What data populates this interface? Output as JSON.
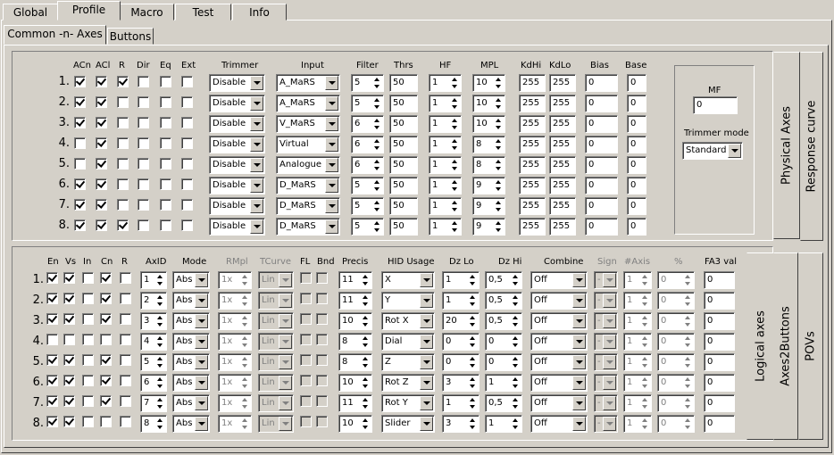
{
  "tabs": {
    "main": [
      "Global",
      "Profile",
      "Macro",
      "Test",
      "Info"
    ],
    "sub": [
      "Common -n- Axes",
      "Buttons"
    ]
  },
  "side_tabs": {
    "top": [
      "Physical Axes",
      "Response curve"
    ],
    "bottom": [
      "Logical axes",
      "Axes2Buttons",
      "POVs"
    ]
  },
  "physical": {
    "headers": [
      "ACn",
      "ACl",
      "R",
      "Dir",
      "Eq",
      "Ext",
      "Trimmer",
      "Input",
      "Filter",
      "Thrs",
      "HF",
      "MPL",
      "KdHi",
      "KdLo",
      "Bias",
      "Base"
    ],
    "rows": [
      {
        "num": "1.",
        "checks": [
          1,
          1,
          1,
          0,
          0,
          0
        ],
        "trimmer": "Disable",
        "input": "A_MaRS",
        "filter": "5",
        "thrs": "50",
        "hf": "1",
        "mpl": "10",
        "kdhi": "255",
        "kdlo": "255",
        "bias": "0",
        "base": "0"
      },
      {
        "num": "2.",
        "checks": [
          1,
          1,
          0,
          0,
          0,
          0
        ],
        "trimmer": "Disable",
        "input": "A_MaRS",
        "filter": "5",
        "thrs": "50",
        "hf": "1",
        "mpl": "10",
        "kdhi": "255",
        "kdlo": "255",
        "bias": "0",
        "base": "0"
      },
      {
        "num": "3.",
        "checks": [
          1,
          1,
          0,
          0,
          0,
          0
        ],
        "trimmer": "Disable",
        "input": "V_MaRS",
        "filter": "6",
        "thrs": "50",
        "hf": "1",
        "mpl": "10",
        "kdhi": "255",
        "kdlo": "255",
        "bias": "0",
        "base": "0"
      },
      {
        "num": "4.",
        "checks": [
          0,
          1,
          0,
          0,
          0,
          0
        ],
        "trimmer": "Disable",
        "input": "Virtual",
        "filter": "6",
        "thrs": "50",
        "hf": "1",
        "mpl": "8",
        "kdhi": "255",
        "kdlo": "255",
        "bias": "0",
        "base": "0"
      },
      {
        "num": "5.",
        "checks": [
          0,
          1,
          0,
          0,
          0,
          0
        ],
        "trimmer": "Disable",
        "input": "Analogue",
        "filter": "6",
        "thrs": "50",
        "hf": "1",
        "mpl": "8",
        "kdhi": "255",
        "kdlo": "255",
        "bias": "0",
        "base": "0"
      },
      {
        "num": "6.",
        "checks": [
          1,
          1,
          0,
          0,
          0,
          0
        ],
        "trimmer": "Disable",
        "input": "D_MaRS",
        "filter": "5",
        "thrs": "50",
        "hf": "1",
        "mpl": "9",
        "kdhi": "255",
        "kdlo": "255",
        "bias": "0",
        "base": "0"
      },
      {
        "num": "7.",
        "checks": [
          1,
          1,
          0,
          0,
          0,
          0
        ],
        "trimmer": "Disable",
        "input": "D_MaRS",
        "filter": "5",
        "thrs": "50",
        "hf": "1",
        "mpl": "9",
        "kdhi": "255",
        "kdlo": "255",
        "bias": "0",
        "base": "0"
      },
      {
        "num": "8.",
        "checks": [
          1,
          1,
          1,
          0,
          0,
          0
        ],
        "trimmer": "Disable",
        "input": "D_MaRS",
        "filter": "5",
        "thrs": "50",
        "hf": "1",
        "mpl": "9",
        "kdhi": "255",
        "kdlo": "255",
        "bias": "0",
        "base": "0"
      }
    ],
    "mf": {
      "label": "MF",
      "value": "0",
      "trimmer_mode_label": "Trimmer mode",
      "trimmer_mode": "Standard"
    }
  },
  "logical": {
    "headers": [
      "En",
      "Vs",
      "In",
      "Cn",
      "R",
      "AxID",
      "Mode",
      "RMpl",
      "TCurve",
      "FL",
      "Bnd",
      "Precis",
      "HID Usage",
      "Dz Lo",
      "Dz Hi",
      "Combine",
      "Sign",
      "#Axis",
      "%",
      "FA3 val"
    ],
    "rows": [
      {
        "num": "1.",
        "checks": [
          1,
          1,
          0,
          1,
          0
        ],
        "axid": "1",
        "mode": "Abs",
        "rmpl": "1x",
        "tcurve": "Lin",
        "precis": "11",
        "hid": "X",
        "dzlo": "1",
        "dzhi": "0,5",
        "combine": "Off",
        "sign": "-",
        "axis": "1",
        "pct": "0",
        "fa3": "0"
      },
      {
        "num": "2.",
        "checks": [
          1,
          1,
          0,
          1,
          0
        ],
        "axid": "2",
        "mode": "Abs",
        "rmpl": "1x",
        "tcurve": "Lin",
        "precis": "11",
        "hid": "Y",
        "dzlo": "1",
        "dzhi": "0,5",
        "combine": "Off",
        "sign": "-",
        "axis": "1",
        "pct": "0",
        "fa3": "0"
      },
      {
        "num": "3.",
        "checks": [
          1,
          1,
          0,
          1,
          0
        ],
        "axid": "3",
        "mode": "Abs",
        "rmpl": "1x",
        "tcurve": "Lin",
        "precis": "10",
        "hid": "Rot X",
        "dzlo": "20",
        "dzhi": "0,5",
        "combine": "Off",
        "sign": "-",
        "axis": "1",
        "pct": "0",
        "fa3": "0"
      },
      {
        "num": "4.",
        "checks": [
          0,
          0,
          0,
          0,
          0
        ],
        "axid": "4",
        "mode": "Abs",
        "rmpl": "1x",
        "tcurve": "Lin",
        "precis": "8",
        "hid": "Dial",
        "dzlo": "0",
        "dzhi": "0",
        "combine": "Off",
        "sign": "-",
        "axis": "1",
        "pct": "0",
        "fa3": "0"
      },
      {
        "num": "5.",
        "checks": [
          1,
          1,
          0,
          1,
          0
        ],
        "axid": "5",
        "mode": "Abs",
        "rmpl": "1x",
        "tcurve": "Lin",
        "precis": "8",
        "hid": "Z",
        "dzlo": "0",
        "dzhi": "0",
        "combine": "Off",
        "sign": "-",
        "axis": "1",
        "pct": "0",
        "fa3": "0"
      },
      {
        "num": "6.",
        "checks": [
          1,
          1,
          0,
          1,
          0
        ],
        "axid": "6",
        "mode": "Abs",
        "rmpl": "1x",
        "tcurve": "Lin",
        "precis": "10",
        "hid": "Rot Z",
        "dzlo": "3",
        "dzhi": "1",
        "combine": "Off",
        "sign": "-",
        "axis": "1",
        "pct": "0",
        "fa3": "0"
      },
      {
        "num": "7.",
        "checks": [
          1,
          1,
          0,
          1,
          0
        ],
        "axid": "7",
        "mode": "Abs",
        "rmpl": "1x",
        "tcurve": "Lin",
        "precis": "11",
        "hid": "Rot Y",
        "dzlo": "1",
        "dzhi": "0,5",
        "combine": "Off",
        "sign": "-",
        "axis": "1",
        "pct": "0",
        "fa3": "0"
      },
      {
        "num": "8.",
        "checks": [
          1,
          1,
          0,
          0,
          0
        ],
        "axid": "8",
        "mode": "Abs",
        "rmpl": "1x",
        "tcurve": "Lin",
        "precis": "10",
        "hid": "Slider",
        "dzlo": "3",
        "dzhi": "1",
        "combine": "Off",
        "sign": "-",
        "axis": "1",
        "pct": "0",
        "fa3": "0"
      }
    ]
  }
}
